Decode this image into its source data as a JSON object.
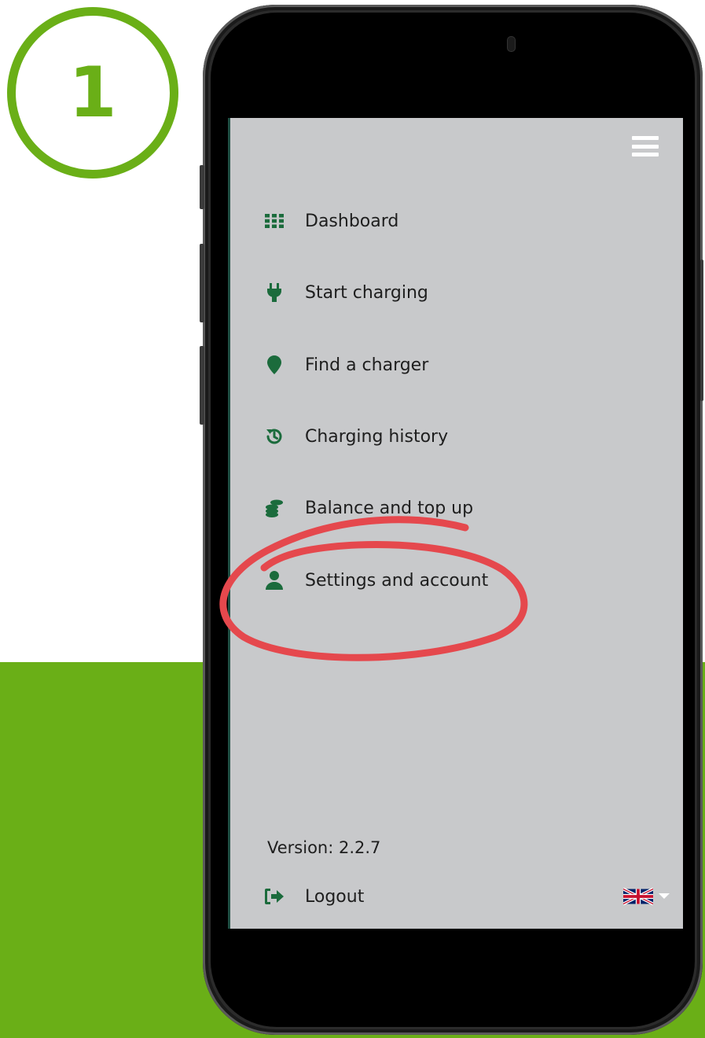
{
  "step": {
    "number": "1"
  },
  "menu": {
    "items": [
      {
        "label": "Dashboard",
        "icon": "dashboard-grid-icon"
      },
      {
        "label": "Start charging",
        "icon": "plug-icon"
      },
      {
        "label": "Find a charger",
        "icon": "map-pin-icon"
      },
      {
        "label": "Charging history",
        "icon": "history-icon"
      },
      {
        "label": "Balance and top up",
        "icon": "coins-icon"
      },
      {
        "label": "Settings and account",
        "icon": "user-icon"
      }
    ]
  },
  "footer": {
    "version": "Version: 2.2.7",
    "logout_label": "Logout",
    "language_flag": "uk-flag-icon"
  },
  "colors": {
    "brand_green": "#6aaf17",
    "icon_green": "#1b6b3c",
    "screen_bg": "#c8c9cb",
    "annotation_red": "#e5484d"
  }
}
